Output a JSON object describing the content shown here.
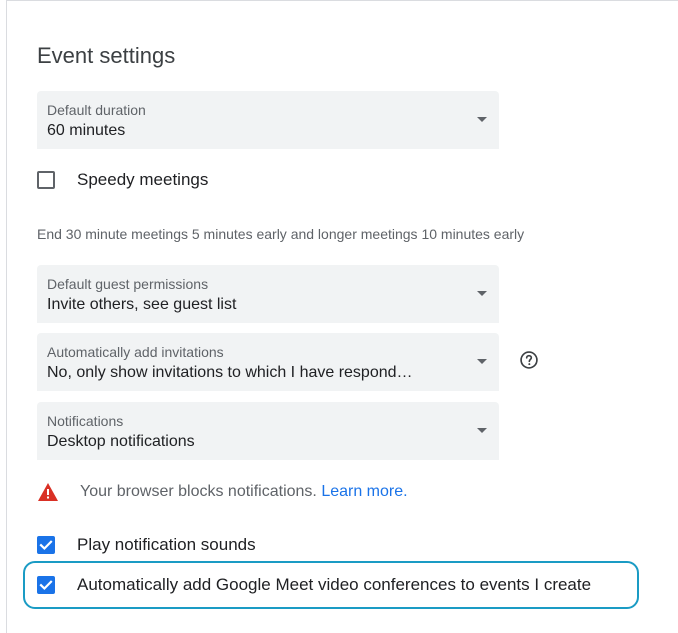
{
  "section": {
    "title": "Event settings"
  },
  "default_duration": {
    "label": "Default duration",
    "value": "60 minutes"
  },
  "speedy_meetings": {
    "label": "Speedy meetings",
    "checked": false,
    "helper": "End 30 minute meetings 5 minutes early and longer meetings 10 minutes early"
  },
  "guest_permissions": {
    "label": "Default guest permissions",
    "value": "Invite others, see guest list"
  },
  "add_invitations": {
    "label": "Automatically add invitations",
    "value": "No, only show invitations to which I have respond…",
    "help_icon": "help-circle-icon"
  },
  "notifications": {
    "label": "Notifications",
    "value": "Desktop notifications"
  },
  "browser_warning": {
    "icon": "warning-triangle-icon",
    "icon_color": "#d93025",
    "text": "Your browser blocks notifications.",
    "link": "Learn more."
  },
  "play_sounds": {
    "label": "Play notification sounds",
    "checked": true
  },
  "auto_meet": {
    "label": "Automatically add Google Meet video conferences to events I create",
    "checked": true,
    "highlight_color": "#1a9bc4"
  },
  "colors": {
    "accent": "#1a73e8",
    "field_bg": "#f1f3f4",
    "text_primary": "#202124",
    "text_secondary": "#5f6368"
  }
}
